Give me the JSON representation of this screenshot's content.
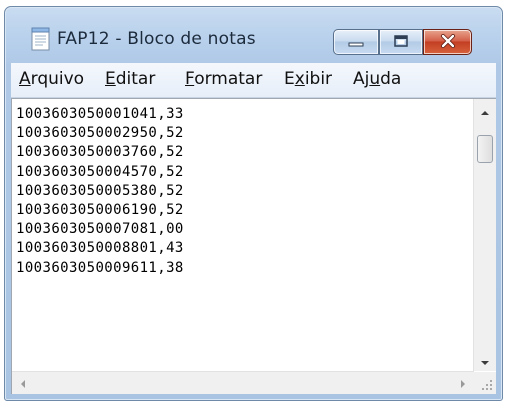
{
  "window": {
    "title": "FAP12 - Bloco de notas",
    "app_icon": "notepad-icon"
  },
  "controls": {
    "minimize_icon": "minimize-icon",
    "maximize_icon": "maximize-icon",
    "close_icon": "close-icon",
    "close_color": "#c94a2e"
  },
  "menu": {
    "items": [
      {
        "label": "Arquivo",
        "accel": "A",
        "rest": "rquivo"
      },
      {
        "label": "Editar",
        "accel": "E",
        "rest": "ditar"
      },
      {
        "label": "Formatar",
        "accel": "F",
        "rest": "ormatar"
      },
      {
        "label": "Exibir",
        "pre": "E",
        "accel": "x",
        "rest": "ibir"
      },
      {
        "label": "Ajuda",
        "pre": "Aj",
        "accel": "u",
        "rest": "da"
      }
    ]
  },
  "editor": {
    "lines": [
      "1003603050001041,33",
      "1003603050002950,52",
      "1003603050003760,52",
      "1003603050004570,52",
      "1003603050005380,52",
      "1003603050006190,52",
      "1003603050007081,00",
      "1003603050008801,43",
      "1003603050009611,38"
    ]
  }
}
